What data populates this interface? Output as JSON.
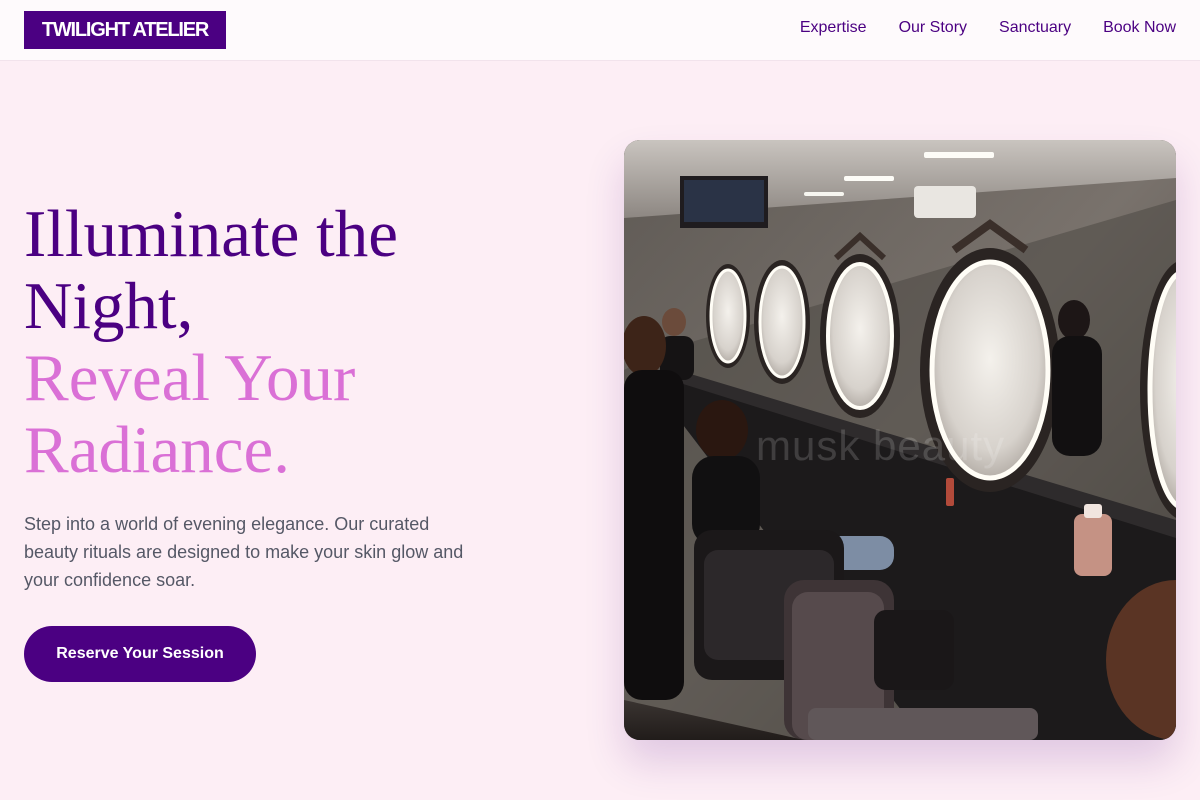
{
  "brand": {
    "name": "TWILIGHT ATELIER"
  },
  "nav": {
    "links": [
      {
        "label": "Expertise"
      },
      {
        "label": "Our Story"
      },
      {
        "label": "Sanctuary"
      },
      {
        "label": "Book Now"
      }
    ]
  },
  "hero": {
    "title_line1": "Illuminate the",
    "title_line2": "Night,",
    "title_line3": "Reveal Your",
    "title_line4": "Radiance.",
    "description": "Step into a world of evening elegance. Our curated beauty rituals are designed to make your skin glow and your confidence soar.",
    "cta_label": "Reserve Your Session",
    "image_watermark": "musk beauty"
  },
  "colors": {
    "page_background": "#fdeef5",
    "primary_purple": "#4b0082",
    "accent_orchid": "#da70d6",
    "body_text": "#555866"
  }
}
